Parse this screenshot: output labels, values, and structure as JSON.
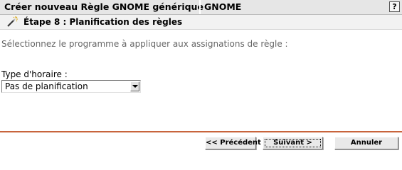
{
  "header": {
    "title": "Créer nouveau Règle GNOME générique",
    "subtitle": "GNOME",
    "help_label": "?"
  },
  "step": {
    "title": "Étape 8 : Planification des règles",
    "icon": "wand-icon"
  },
  "content": {
    "instructions": "Sélectionnez le programme à appliquer aux assignations de règle :",
    "schedule_type_label": "Type d'horaire :",
    "schedule_type_value": "Pas de planification"
  },
  "footer": {
    "previous_label": "<< Précédent",
    "next_label": "Suivant >",
    "cancel_label": "Annuler"
  },
  "colors": {
    "header_bg": "#e6e6e6",
    "divider": "#c8643c",
    "instruction_text": "#666666"
  }
}
